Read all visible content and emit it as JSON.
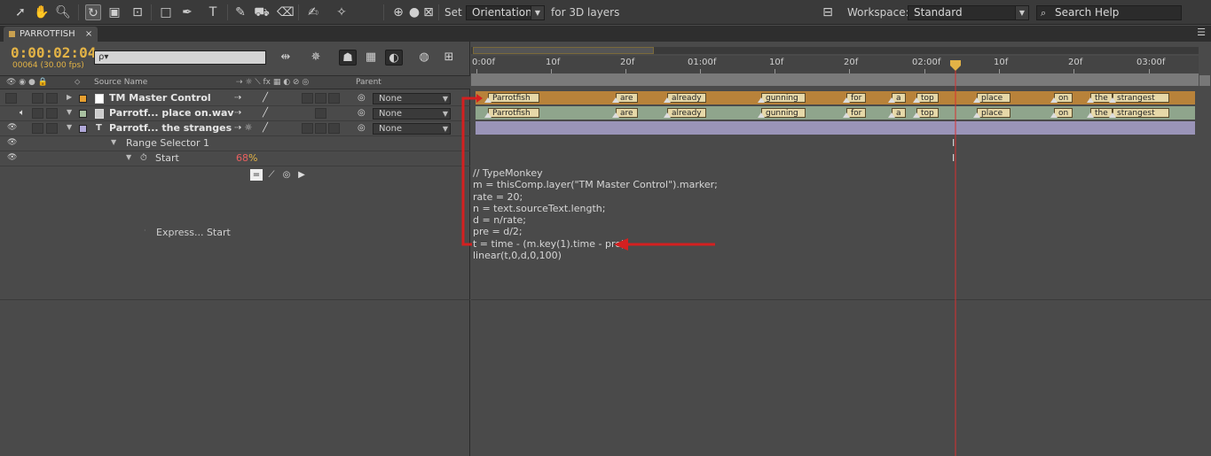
{
  "toolbar": {
    "set_label": "Set",
    "orientation_select": "Orientation",
    "for_3d_label": "for 3D layers",
    "workspace_label": "Workspace:",
    "workspace_select": "Standard",
    "search_help": "Search Help"
  },
  "panel": {
    "tab_name": "PARROTFISH",
    "tab_close": "×"
  },
  "timeline": {
    "timecode": "0:00:02:04",
    "fps": "00064 (30.00 fps)",
    "search_placeholder": "ρ▾",
    "columns": {
      "source_name": "Source Name",
      "parent": "Parent"
    },
    "layers": [
      {
        "name": "TM Master Control",
        "parent": "None",
        "color": "#e8a030"
      },
      {
        "name": "Parrotf... place on.wav",
        "parent": "None",
        "color": "#a8c0a0"
      },
      {
        "name": "Parrotf... the stranges",
        "parent": "None",
        "color": "#b0a8d8"
      }
    ],
    "range_selector": "Range Selector 1",
    "start_label": "Start",
    "start_value": "68",
    "start_unit": "%",
    "expression_label": "Express... Start",
    "ruler_labels": [
      "0:00f",
      "10f",
      "20f",
      "01:00f",
      "10f",
      "20f",
      "02:00f",
      "10f",
      "20f",
      "03:00f"
    ],
    "markers": [
      "Parrotfish",
      "are",
      "already",
      "gunning",
      "for",
      "a",
      "top",
      "place",
      "on",
      "the",
      "strangest"
    ],
    "expression_code": [
      "// TypeMonkey",
      "m = thisComp.layer(\"TM Master Control\").marker;",
      "rate = 20;",
      "n = text.sourceText.length;",
      "d = n/rate;",
      "pre = d/2;",
      "t = time - (m.key(1).time - pre);",
      "linear(t,0,d,0,100)"
    ]
  },
  "colors": {
    "timecode": "#e3b346",
    "annotation": "#d42020",
    "playhead": "#d83030"
  }
}
